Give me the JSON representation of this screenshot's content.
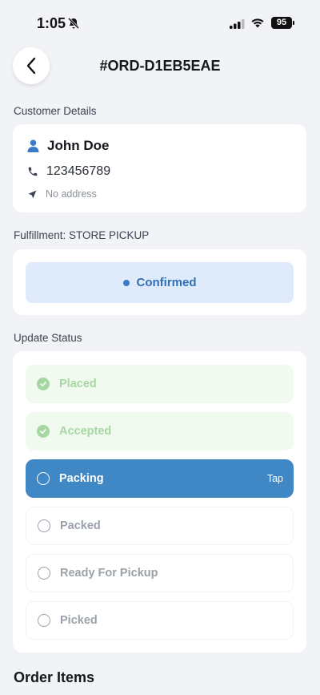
{
  "status_bar": {
    "time": "1:05",
    "battery": "95"
  },
  "header": {
    "order_id": "#ORD-D1EB5EAE"
  },
  "customer": {
    "section_label": "Customer Details",
    "name": "John Doe",
    "phone": "123456789",
    "address": "No address"
  },
  "fulfillment": {
    "section_label": "Fulfillment: STORE PICKUP",
    "status": "Confirmed"
  },
  "update_status": {
    "section_label": "Update Status",
    "steps": [
      {
        "label": "Placed",
        "state": "done"
      },
      {
        "label": "Accepted",
        "state": "done"
      },
      {
        "label": "Packing",
        "state": "current",
        "hint": "Tap"
      },
      {
        "label": "Packed",
        "state": "pending"
      },
      {
        "label": "Ready For Pickup",
        "state": "pending"
      },
      {
        "label": "Picked",
        "state": "pending"
      }
    ]
  },
  "order_items": {
    "section_label": "Order Items"
  },
  "colors": {
    "accent": "#3f88c5",
    "done": "#a6d7a2",
    "status_bg": "#dfebfa"
  }
}
